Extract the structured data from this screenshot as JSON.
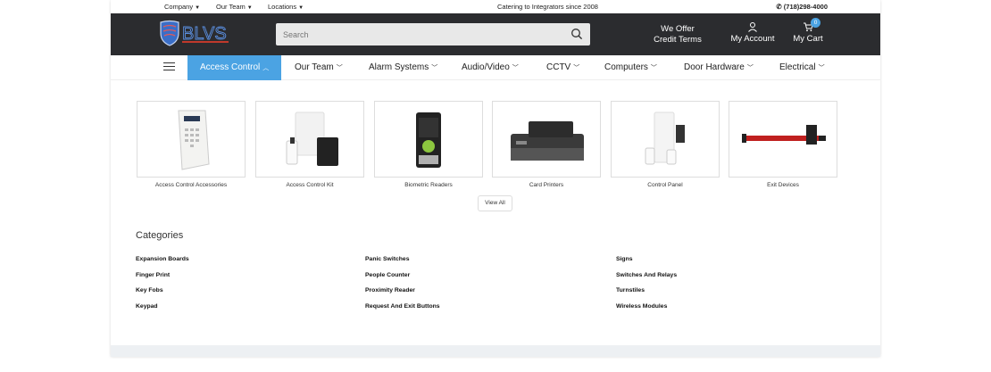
{
  "topbar": {
    "links": [
      {
        "label": "Company"
      },
      {
        "label": "Our Team"
      },
      {
        "label": "Locations"
      }
    ],
    "tagline": "Catering to Integrators since 2008",
    "phone": "(718)298-4000"
  },
  "header": {
    "logo_text": "BLVS",
    "search": {
      "placeholder": "Search"
    },
    "offer_line1": "We Offer",
    "offer_line2": "Credit Terms",
    "account_label": "My Account",
    "cart_label": "My Cart",
    "cart_count": "0",
    "colors": {
      "bar": "#2b2c2f",
      "accent": "#4ba3e3"
    }
  },
  "nav": {
    "items": [
      {
        "label": "Access Control"
      },
      {
        "label": "Our Team"
      },
      {
        "label": "Alarm Systems"
      },
      {
        "label": "Audio/Video"
      },
      {
        "label": "CCTV"
      },
      {
        "label": "Computers"
      },
      {
        "label": "Door Hardware"
      },
      {
        "label": "Electrical"
      }
    ]
  },
  "products": [
    {
      "label": "Access Control Accessories",
      "icon": "keypad-product-icon"
    },
    {
      "label": "Access Control Kit",
      "icon": "access-kit-product-icon"
    },
    {
      "label": "Biometric Readers",
      "icon": "biometric-reader-product-icon"
    },
    {
      "label": "Card Printers",
      "icon": "card-printer-product-icon"
    },
    {
      "label": "Control Panel",
      "icon": "control-panel-product-icon"
    },
    {
      "label": "Exit Devices",
      "icon": "exit-device-product-icon"
    }
  ],
  "view_all": "View All",
  "categories": {
    "heading": "Categories",
    "col1": [
      "Expansion Boards",
      "Finger Print",
      "Key Fobs",
      "Keypad"
    ],
    "col2": [
      "Panic Switches",
      "People Counter",
      "Proximity Reader",
      "Request And Exit Buttons"
    ],
    "col3": [
      "Signs",
      "Switches And Relays",
      "Turnstiles",
      "Wireless Modules"
    ]
  }
}
